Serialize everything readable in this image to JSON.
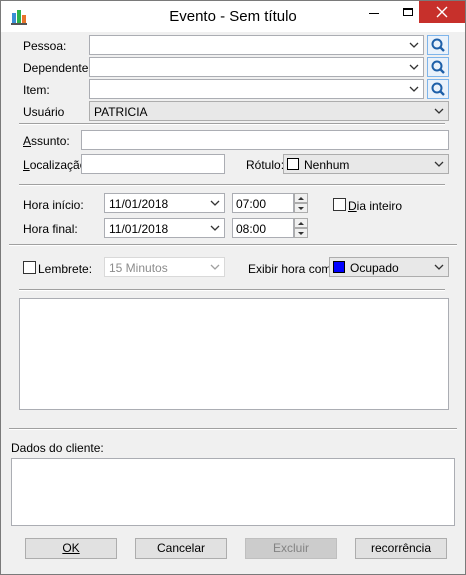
{
  "window": {
    "title": "Evento - Sem título"
  },
  "fields": {
    "pessoa_label": "Pessoa:",
    "dependente_label": "Dependente:",
    "item_label": "Item:",
    "usuario_label": "Usuário",
    "usuario_value": "PATRICIA",
    "assunto_label": "Assunto:",
    "localizacao_label": "Localização:",
    "rotulo_label": "Rótulo:",
    "rotulo_value": "Nenhum",
    "rotulo_color": "#ffffff"
  },
  "time": {
    "hora_inicio_label": "Hora início:",
    "hora_inicio_date": "11/01/2018",
    "hora_inicio_time": "07:00",
    "hora_final_label": "Hora final:",
    "hora_final_date": "11/01/2018",
    "hora_final_time": "08:00",
    "dia_inteiro_label": "Dia inteiro",
    "dia_inteiro_checked": false
  },
  "reminder": {
    "lembrete_label": "Lembrete:",
    "lembrete_checked": false,
    "lembrete_value": "15 Minutos",
    "exibir_label": "Exibir hora como",
    "exibir_value": "Ocupado",
    "exibir_color": "#0000ff"
  },
  "dados_label": "Dados do cliente:",
  "buttons": {
    "ok": "OK",
    "cancelar": "Cancelar",
    "excluir": "Excluir",
    "recorrencia": "recorrência"
  }
}
